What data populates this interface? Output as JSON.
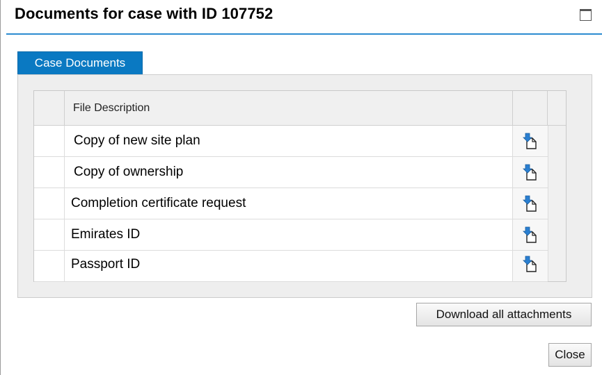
{
  "dialog": {
    "title": "Documents for case with ID 107752",
    "maximize_icon": "window-maximize-icon"
  },
  "tabs": [
    {
      "label": "Case Documents",
      "selected": true
    }
  ],
  "table": {
    "columns": [
      "File Description"
    ],
    "rows": [
      {
        "description": "Copy of new site plan",
        "action_icon": "download-document-icon"
      },
      {
        "description": "Copy of ownership",
        "action_icon": "download-document-icon"
      },
      {
        "description": "Completion certificate request",
        "action_icon": "download-document-icon"
      },
      {
        "description": "Emirates ID",
        "action_icon": "download-document-icon"
      },
      {
        "description": "Passport ID",
        "action_icon": "download-document-icon"
      }
    ]
  },
  "buttons": {
    "download_all": "Download all attachments",
    "close": "Close"
  },
  "colors": {
    "accent": "#0a79c2",
    "title_rule": "#2b8bd0",
    "icon_arrow": "#2a7fd1"
  }
}
